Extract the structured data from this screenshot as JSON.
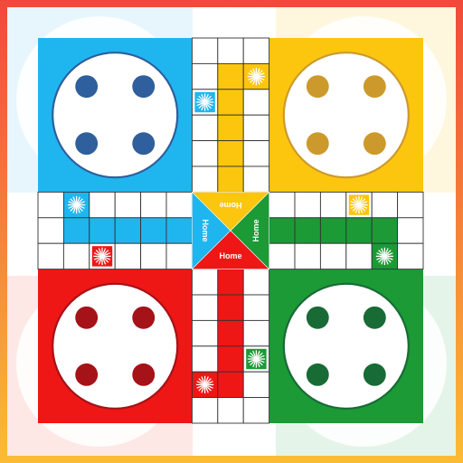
{
  "colors": {
    "blue": "#1fb6f0",
    "yellow": "#fcc60f",
    "red": "#ef1616",
    "green": "#1b9a36",
    "blue_token": "#2f5f9c",
    "yellow_token": "#cc9a2c",
    "red_token": "#a51218",
    "green_token": "#186b35",
    "frame_top": "#f0493b",
    "frame_bottom": "#fbbc35",
    "grid_line": "#333333",
    "circle_fill": "#ffffff"
  },
  "center": {
    "top_label": "Home",
    "right_label": "Home",
    "bottom_label": "Home",
    "left_label": "Home"
  },
  "yards": [
    {
      "color": "blue",
      "tokens": 4
    },
    {
      "color": "yellow",
      "tokens": 4
    },
    {
      "color": "red",
      "tokens": 4
    },
    {
      "color": "green",
      "tokens": 4
    }
  ],
  "safe_star_icon": "star-burst-icon"
}
